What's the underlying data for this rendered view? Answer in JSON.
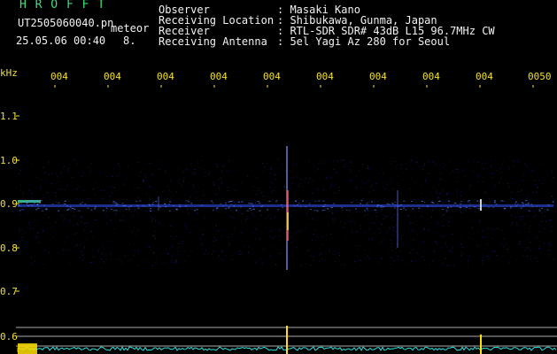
{
  "header": {
    "brand": "H R O F F T",
    "filename": "UT2505060040.pn",
    "mode_label": "meteor",
    "datetime": "25.05.06 00:40",
    "count": "8.",
    "fields": [
      {
        "label": "Observer",
        "value": ": Masaki Kano"
      },
      {
        "label": "Receiving Location",
        "value": ": Shibukawa, Gunma, Japan"
      },
      {
        "label": "Receiver",
        "value": ": RTL-SDR SDR# 43dB L15 96.7MHz CW"
      },
      {
        "label": "Receiving Antenna",
        "value": ": 5el Yagi Az 280 for Seoul"
      }
    ]
  },
  "axis": {
    "unit": "kHz",
    "time_ticks": [
      "004",
      "004",
      "004",
      "004",
      "004",
      "004",
      "004",
      "004",
      "004",
      "0050"
    ],
    "freq_ticks": [
      "1.1",
      "1.0",
      "0.9",
      "0.8",
      "0.7",
      "0.6"
    ]
  },
  "colors": {
    "background": "#000000",
    "label": "#f0e030",
    "brand": "#3ee07a",
    "text": "#f2f2f2",
    "noise": "#1a2a9a",
    "baseline": "#3355ff",
    "amplitude": "#27e0e0",
    "spike": "#ffe000"
  }
}
